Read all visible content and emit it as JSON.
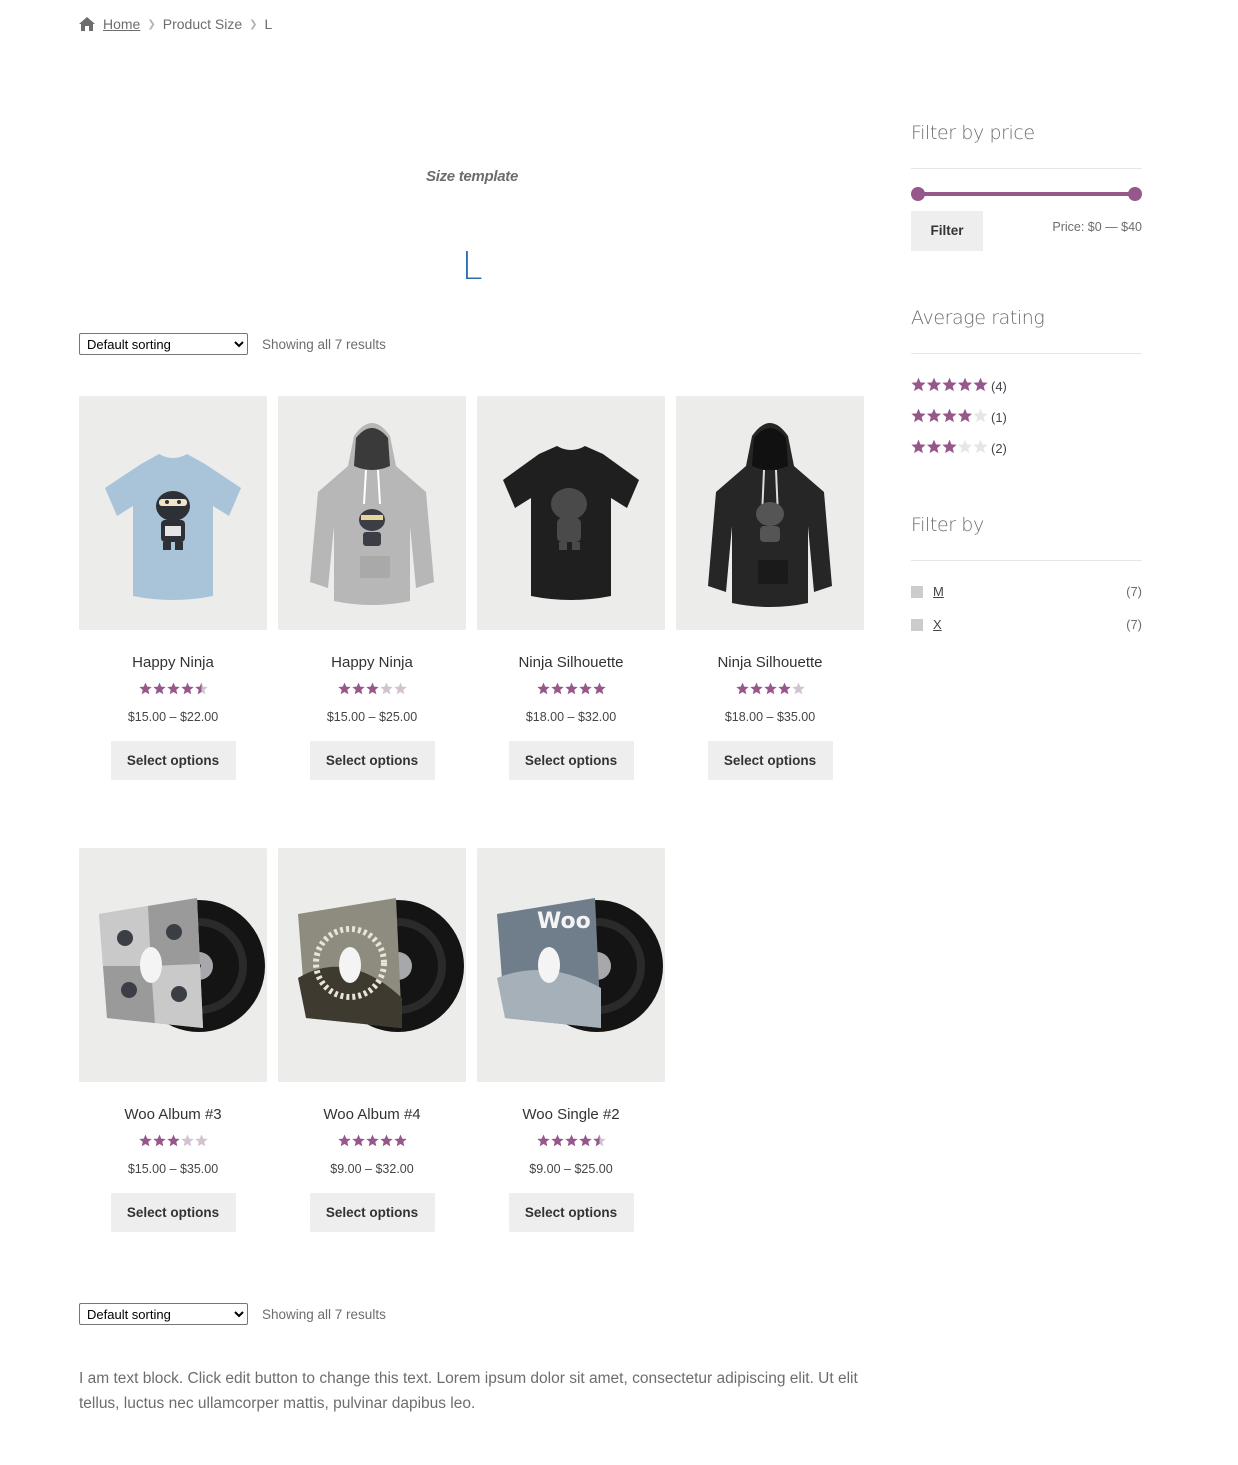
{
  "colors": {
    "accent": "#96588a",
    "star_empty": "#d3c2cf",
    "link_blue": "#2c6cb3"
  },
  "breadcrumb": {
    "home_icon": "home-icon",
    "home": "Home",
    "category": "Product Size",
    "current": "L"
  },
  "template": {
    "heading": "Size template",
    "size": "L"
  },
  "ordering": {
    "select_value": "Default sorting",
    "result_count": "Showing all 7 results"
  },
  "products": [
    {
      "name": "Happy Ninja",
      "rating": 4.5,
      "price": "$15.00 – $22.00",
      "button": "Select options",
      "image": "tshirt-blue"
    },
    {
      "name": "Happy Ninja",
      "rating": 3.0,
      "price": "$15.00 – $25.00",
      "button": "Select options",
      "image": "hoodie-grey"
    },
    {
      "name": "Ninja Silhouette",
      "rating": 5.0,
      "price": "$18.00 – $32.00",
      "button": "Select options",
      "image": "tshirt-black"
    },
    {
      "name": "Ninja Silhouette",
      "rating": 4.0,
      "price": "$18.00 – $35.00",
      "button": "Select options",
      "image": "hoodie-black"
    },
    {
      "name": "Woo Album #3",
      "rating": 3.0,
      "price": "$15.00 – $35.00",
      "button": "Select options",
      "image": "album-ninjas"
    },
    {
      "name": "Woo Album #4",
      "rating": 5.0,
      "price": "$9.00 – $32.00",
      "button": "Select options",
      "image": "album-woothemes"
    },
    {
      "name": "Woo Single #2",
      "rating": 4.5,
      "price": "$9.00 – $25.00",
      "button": "Select options",
      "image": "single-woo"
    }
  ],
  "sidebar": {
    "price_filter": {
      "title": "Filter by price",
      "button": "Filter",
      "label": "Price: $0 — $40",
      "min_fraction": 0,
      "max_fraction": 1
    },
    "average_rating": {
      "title": "Average rating",
      "rows": [
        {
          "stars": 5,
          "count": "(4)"
        },
        {
          "stars": 4,
          "count": "(1)"
        },
        {
          "stars": 3,
          "count": "(2)"
        }
      ]
    },
    "filter_by": {
      "title": "Filter by",
      "items": [
        {
          "label": "M",
          "count": "(7)"
        },
        {
          "label": "X",
          "count": "(7)"
        }
      ]
    }
  },
  "text_block": "I am text block. Click edit button to change this text. Lorem ipsum dolor sit amet, consectetur adipiscing elit. Ut elit tellus, luctus nec ullamcorper mattis, pulvinar dapibus leo."
}
